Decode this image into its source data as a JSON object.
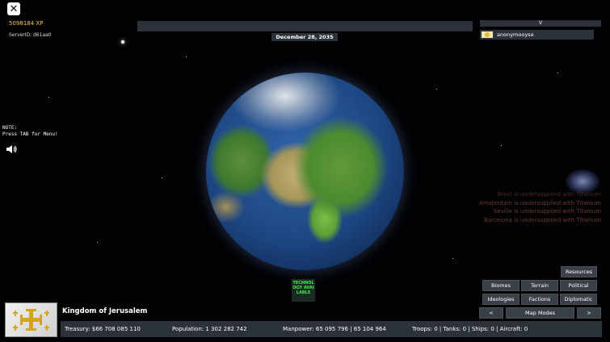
{
  "top_left": {
    "xp": "5098184 XP",
    "server_id": "ServerID: d61aa0"
  },
  "header": {
    "date": "December 28, 2035",
    "collapse_label": "V"
  },
  "players": [
    {
      "name": "anonymooyse"
    }
  ],
  "note": {
    "line1": "NOTE:",
    "line2": "Press TAB for Menu!"
  },
  "event_log": [
    "Brest is undersupplied with Titanium",
    "Amsterdam is undersupplied with Titanium",
    "Seville is undersupplied with Titanium",
    "Barcelona is undersupplied with Titanium"
  ],
  "technology_notice": "TECHNOLOGY AVAILABLE",
  "map_buttons": {
    "resources": "Resources",
    "biomes": "Biomes",
    "terrain": "Terrain",
    "political": "Political",
    "ideologies": "Ideologies",
    "factions": "Factions",
    "diplomatic": "Diplomatic",
    "prev": "<",
    "map_modes": "Map Modes",
    "next": ">"
  },
  "country": {
    "name": "Kingdom of Jerusalem",
    "treasury": "Treasury:  $66 708 085 110",
    "population": "Population: 1 302 282 742",
    "manpower": "Manpower:  65 095 796  |  65 104 964",
    "military": "Troops: 0  |  Tanks: 0  |  Ships: 0  |  Aircraft: 0"
  },
  "colors": {
    "panel": "#2c3239",
    "xp_gold": "#f5c542",
    "tech_green": "#3cf04a",
    "log_red": "#6a3a2e"
  }
}
